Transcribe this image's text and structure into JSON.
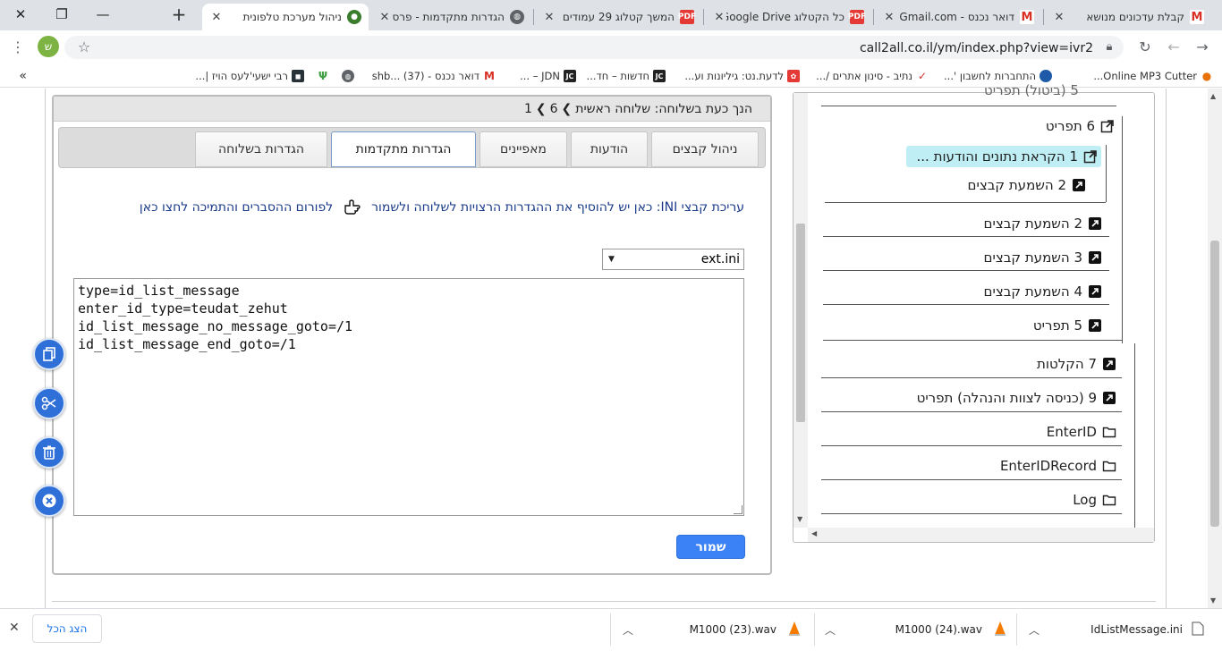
{
  "browser": {
    "tabs": [
      {
        "title": "ניהול מערכת טלפונית",
        "active": true
      },
      {
        "title": "הגדרות מתקדמות - פרס",
        "active": false
      },
      {
        "title": "המשך קטלוג 29 עמודים",
        "active": false
      },
      {
        "title": "כל הקטלוג Google Drive",
        "active": false
      },
      {
        "title": "דואר נכנס - Gmail.com",
        "active": false
      },
      {
        "title": "קבלת עדכונים מנושא",
        "active": false
      }
    ],
    "url": "call2all.co.il/ym/index.php?view=ivr2",
    "avatar_letter": "ש",
    "bookmarks": [
      "Online MP3 Cutter...",
      "התחברות לחשבון '...",
      "נתיב - סינון אתרים /...",
      "לדעת.נט: גיליונות וע...",
      "חדשות – חד...",
      "JDN – ...",
      "דואר נכנס - shb... (37)",
      "רבי ישעי'לעס הויז |..."
    ],
    "bookmarks_more": "»"
  },
  "panel": {
    "header_prefix": "הנך כעת בשלוחה: שלוחה ראשית",
    "crumb_1": "6",
    "crumb_2": "1",
    "tabs": [
      {
        "label": "ניהול קבצים"
      },
      {
        "label": "הודעות"
      },
      {
        "label": "מאפיינים"
      },
      {
        "label": "הגדרות מתקדמות"
      },
      {
        "label": "הגדרות בשלוחה"
      }
    ],
    "note_part1": "עריכת קבצי INI: כאן יש להוסיף את ההגדרות הרצויות לשלוחה ולשמור",
    "note_link": "לפורום ההסברים והתמיכה לחצו כאן",
    "select_value": "ext.ini",
    "editor_lines": [
      "type=id_list_message",
      "enter_id_type=teudat_zehut",
      "id_list_message_no_message_goto=/1",
      "id_list_message_end_goto=/1"
    ],
    "save_label": "שמור"
  },
  "fabs": [
    {
      "icon": "copy-icon"
    },
    {
      "icon": "scissors-icon"
    },
    {
      "icon": "trash-icon"
    },
    {
      "icon": "close-icon"
    }
  ],
  "tree": {
    "partial_top": "5 (ביטול) תפריט",
    "nodes": [
      {
        "label": "6 תפריט",
        "icon": "external-link-icon"
      },
      {
        "label": "1 הקראת נתונים והודעות ...",
        "icon": "external-link-icon",
        "highlight": true
      },
      {
        "label": "2 השמעת קבצים",
        "icon": "shortcut-icon"
      },
      {
        "label": "2 השמעת קבצים",
        "icon": "shortcut-icon"
      },
      {
        "label": "3 השמעת קבצים",
        "icon": "shortcut-icon"
      },
      {
        "label": "4 השמעת קבצים",
        "icon": "shortcut-icon"
      },
      {
        "label": "5 תפריט",
        "icon": "shortcut-icon"
      },
      {
        "label": "7 הקלטות",
        "icon": "shortcut-icon"
      },
      {
        "label": "9 (כניסה לצוות והנהלה) תפריט",
        "icon": "shortcut-icon"
      },
      {
        "label": "EnterID",
        "icon": "folder-icon"
      },
      {
        "label": "EnterIDRecord",
        "icon": "folder-icon"
      },
      {
        "label": "Log",
        "icon": "folder-icon"
      }
    ]
  },
  "downloads": {
    "items": [
      {
        "name": "IdListMessage.ini"
      },
      {
        "name": "M1000 (24).wav"
      },
      {
        "name": "M1000 (23).wav"
      }
    ],
    "show_all": "הצג הכל"
  }
}
